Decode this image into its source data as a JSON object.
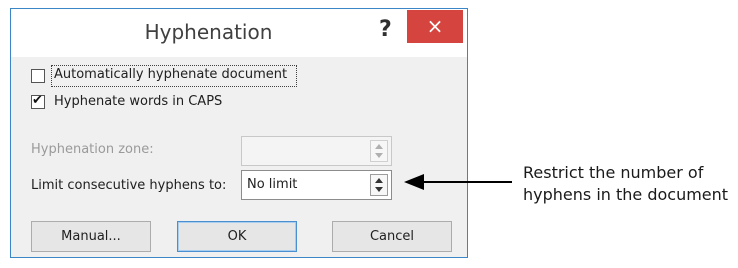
{
  "dialog": {
    "title": "Hyphenation",
    "help_label": "?",
    "close_label": "×",
    "auto_hyphenate": {
      "label": "Automatically hyphenate document",
      "checked": false
    },
    "hyphenate_caps": {
      "label": "Hyphenate words in CAPS",
      "checked": true
    },
    "hyphenation_zone": {
      "label": "Hyphenation zone:",
      "value": "",
      "enabled": false
    },
    "limit_consecutive": {
      "label": "Limit consecutive hyphens to:",
      "value": "No limit"
    },
    "buttons": {
      "manual": "Manual...",
      "ok": "OK",
      "cancel": "Cancel"
    }
  },
  "annotation": {
    "line1": "Restrict the number of",
    "line2": "hyphens in the document"
  }
}
